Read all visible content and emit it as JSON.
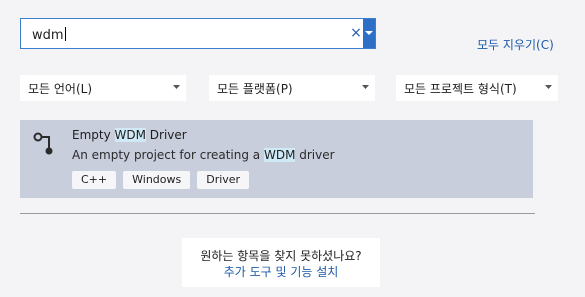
{
  "search": {
    "value": "wdm",
    "clear_icon": "×",
    "dropdown_icon": "chevron-down-icon"
  },
  "clear_all_label": "모두 지우기(C)",
  "filters": {
    "language": "모든 언어(L)",
    "platform": "모든 플랫폼(P)",
    "project_type": "모든 프로젝트 형식(T)"
  },
  "template": {
    "icon": "driver-plug-icon",
    "title_prefix": "Empty ",
    "title_highlight": "WDM",
    "title_suffix": " Driver",
    "desc_prefix": "An empty project for creating a ",
    "desc_highlight": "WDM",
    "desc_suffix": " driver",
    "tags": [
      "C++",
      "Windows",
      "Driver"
    ]
  },
  "help": {
    "question": "원하는 항목을 찾지 못하셨나요?",
    "link": "추가 도구 및 기능 설치"
  },
  "colors": {
    "background": "#f4f4f6",
    "card_selected": "#c9cedd",
    "highlight": "#cfe9f7",
    "link": "#1e5aa8",
    "search_border": "#3c7fd0"
  }
}
